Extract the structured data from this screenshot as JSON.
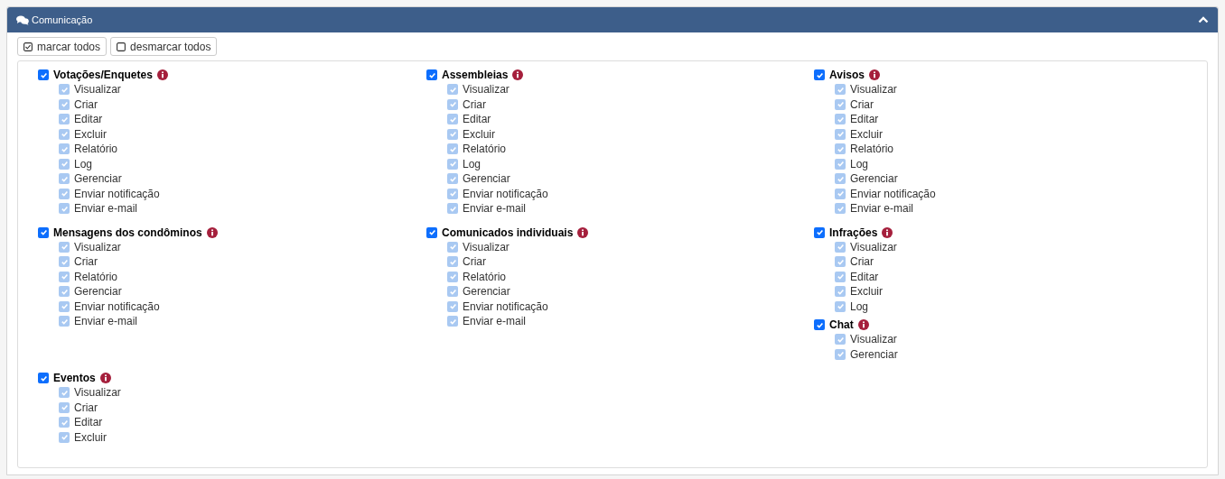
{
  "panel": {
    "title": "Comunicação",
    "expanded": true
  },
  "buttons": [
    {
      "kind": "check",
      "label": "marcar todos"
    },
    {
      "kind": "uncheck",
      "label": "desmarcar todos"
    }
  ],
  "rows": [
    {
      "cells": [
        {
          "groups": [
            {
              "label": "Votações/Enquetes",
              "checked": true,
              "items": [
                {
                  "label": "Visualizar",
                  "checked": true,
                  "disabled": true
                },
                {
                  "label": "Criar",
                  "checked": true,
                  "disabled": true
                },
                {
                  "label": "Editar",
                  "checked": true,
                  "disabled": true
                },
                {
                  "label": "Excluir",
                  "checked": true,
                  "disabled": true
                },
                {
                  "label": "Relatório",
                  "checked": true,
                  "disabled": true
                },
                {
                  "label": "Log",
                  "checked": true,
                  "disabled": true
                },
                {
                  "label": "Gerenciar",
                  "checked": true,
                  "disabled": true
                },
                {
                  "label": "Enviar notificação",
                  "checked": true,
                  "disabled": true
                },
                {
                  "label": "Enviar e-mail",
                  "checked": true,
                  "disabled": true
                }
              ]
            }
          ]
        },
        {
          "groups": [
            {
              "label": "Assembleias",
              "checked": true,
              "items": [
                {
                  "label": "Visualizar",
                  "checked": true,
                  "disabled": true
                },
                {
                  "label": "Criar",
                  "checked": true,
                  "disabled": true
                },
                {
                  "label": "Editar",
                  "checked": true,
                  "disabled": true
                },
                {
                  "label": "Excluir",
                  "checked": true,
                  "disabled": true
                },
                {
                  "label": "Relatório",
                  "checked": true,
                  "disabled": true
                },
                {
                  "label": "Log",
                  "checked": true,
                  "disabled": true
                },
                {
                  "label": "Gerenciar",
                  "checked": true,
                  "disabled": true
                },
                {
                  "label": "Enviar notificação",
                  "checked": true,
                  "disabled": true
                },
                {
                  "label": "Enviar e-mail",
                  "checked": true,
                  "disabled": true
                }
              ]
            }
          ]
        },
        {
          "groups": [
            {
              "label": "Avisos",
              "checked": true,
              "items": [
                {
                  "label": "Visualizar",
                  "checked": true,
                  "disabled": true
                },
                {
                  "label": "Criar",
                  "checked": true,
                  "disabled": true
                },
                {
                  "label": "Editar",
                  "checked": true,
                  "disabled": true
                },
                {
                  "label": "Excluir",
                  "checked": true,
                  "disabled": true
                },
                {
                  "label": "Relatório",
                  "checked": true,
                  "disabled": true
                },
                {
                  "label": "Log",
                  "checked": true,
                  "disabled": true
                },
                {
                  "label": "Gerenciar",
                  "checked": true,
                  "disabled": true
                },
                {
                  "label": "Enviar notificação",
                  "checked": true,
                  "disabled": true
                },
                {
                  "label": "Enviar e-mail",
                  "checked": true,
                  "disabled": true
                }
              ]
            }
          ]
        }
      ]
    },
    {
      "cells": [
        {
          "groups": [
            {
              "label": "Mensagens dos condôminos",
              "checked": true,
              "items": [
                {
                  "label": "Visualizar",
                  "checked": true,
                  "disabled": true
                },
                {
                  "label": "Criar",
                  "checked": true,
                  "disabled": true
                },
                {
                  "label": "Relatório",
                  "checked": true,
                  "disabled": true
                },
                {
                  "label": "Gerenciar",
                  "checked": true,
                  "disabled": true
                },
                {
                  "label": "Enviar notificação",
                  "checked": true,
                  "disabled": true
                },
                {
                  "label": "Enviar e-mail",
                  "checked": true,
                  "disabled": true
                }
              ]
            }
          ]
        },
        {
          "groups": [
            {
              "label": "Comunicados individuais",
              "checked": true,
              "items": [
                {
                  "label": "Visualizar",
                  "checked": true,
                  "disabled": true
                },
                {
                  "label": "Criar",
                  "checked": true,
                  "disabled": true
                },
                {
                  "label": "Relatório",
                  "checked": true,
                  "disabled": true
                },
                {
                  "label": "Gerenciar",
                  "checked": true,
                  "disabled": true
                },
                {
                  "label": "Enviar notificação",
                  "checked": true,
                  "disabled": true
                },
                {
                  "label": "Enviar e-mail",
                  "checked": true,
                  "disabled": true
                }
              ]
            }
          ]
        },
        {
          "groups": [
            {
              "label": "Infrações",
              "checked": true,
              "items": [
                {
                  "label": "Visualizar",
                  "checked": true,
                  "disabled": true
                },
                {
                  "label": "Criar",
                  "checked": true,
                  "disabled": true
                },
                {
                  "label": "Editar",
                  "checked": true,
                  "disabled": true
                },
                {
                  "label": "Excluir",
                  "checked": true,
                  "disabled": true
                },
                {
                  "label": "Log",
                  "checked": true,
                  "disabled": true
                }
              ]
            },
            {
              "label": "Chat",
              "checked": true,
              "items": [
                {
                  "label": "Visualizar",
                  "checked": true,
                  "disabled": true
                },
                {
                  "label": "Gerenciar",
                  "checked": true,
                  "disabled": true
                }
              ]
            }
          ]
        }
      ]
    },
    {
      "cells": [
        {
          "groups": [
            {
              "label": "Eventos",
              "checked": true,
              "items": [
                {
                  "label": "Visualizar",
                  "checked": true,
                  "disabled": true
                },
                {
                  "label": "Criar",
                  "checked": true,
                  "disabled": true
                },
                {
                  "label": "Editar",
                  "checked": true,
                  "disabled": true
                },
                {
                  "label": "Excluir",
                  "checked": true,
                  "disabled": true
                }
              ]
            }
          ]
        }
      ]
    }
  ]
}
